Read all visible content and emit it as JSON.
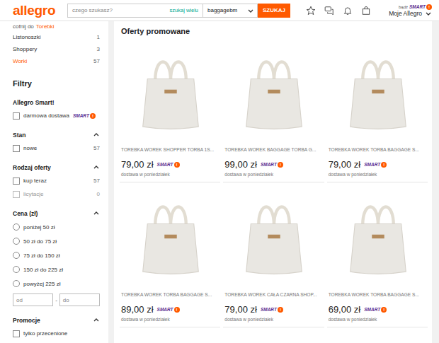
{
  "header": {
    "logo": "allegro",
    "search": {
      "placeholder": "czego szukasz?",
      "link": "szukaj wielu",
      "scope": "baggagebm",
      "button": "SZUKAJ"
    },
    "smart": {
      "prefix": "bądź"
    },
    "account": "Moje Allegro"
  },
  "smart_badge": {
    "label": "SMART",
    "mark": "!"
  },
  "sidebar": {
    "back": {
      "prefix": "cofnij do",
      "link": "Torebki"
    },
    "categories": [
      {
        "label": "Listonoszki",
        "count": "1",
        "selected": false
      },
      {
        "label": "Shoppery",
        "count": "3",
        "selected": false
      },
      {
        "label": "Worki",
        "count": "57",
        "selected": true
      }
    ],
    "filters_title": "Filtry",
    "sections": [
      {
        "title": "Allegro Smart!",
        "items": [
          {
            "kind": "checkbox",
            "label": "darmowa dostawa",
            "smart": true,
            "checked": false,
            "disabled": false
          }
        ]
      },
      {
        "title": "Stan",
        "expanded": true,
        "items": [
          {
            "kind": "checkbox",
            "label": "nowe",
            "count": "57",
            "checked": false,
            "disabled": false
          }
        ]
      },
      {
        "title": "Rodzaj oferty",
        "expanded": true,
        "items": [
          {
            "kind": "checkbox",
            "label": "kup teraz",
            "count": "57",
            "checked": false,
            "disabled": false
          },
          {
            "kind": "checkbox",
            "label": "licytacje",
            "count": "0",
            "checked": false,
            "disabled": true
          }
        ]
      },
      {
        "title": "Cena (zł)",
        "expanded": true,
        "items": [
          {
            "kind": "radio",
            "label": "poniżej 50 zł",
            "selected": false
          },
          {
            "kind": "radio",
            "label": "50 zł do 75 zł",
            "selected": false
          },
          {
            "kind": "radio",
            "label": "75 zł do 150 zł",
            "selected": false
          },
          {
            "kind": "radio",
            "label": "150 zł do 225 zł",
            "selected": false
          },
          {
            "kind": "radio",
            "label": "powyżej 225 zł",
            "selected": false
          },
          {
            "kind": "range",
            "from": "od",
            "separator": "-",
            "to": "do"
          }
        ]
      },
      {
        "title": "Promocje",
        "expanded": true,
        "items": [
          {
            "kind": "checkbox",
            "label": "tylko przecenione",
            "checked": false,
            "disabled": false
          }
        ]
      }
    ]
  },
  "main": {
    "title": "Oferty promowane",
    "products": [
      {
        "title": "TOREBKA WOREK SHOPPER TORBA 1S...",
        "price": "79,00 zł",
        "smart": true,
        "delivery": "dostawa w poniedziałek"
      },
      {
        "title": "TOREBKA WOREK BAGGAGE TORBA G...",
        "price": "99,00 zł",
        "smart": true,
        "delivery": "dostawa w poniedziałek"
      },
      {
        "title": "TOREBKA WOREK TORBA BAGGAGE S...",
        "price": "79,00 zł",
        "smart": true,
        "delivery": "dostawa w poniedziałek"
      },
      {
        "title": "TOREBKA WOREK TORBA BAGGAGE S...",
        "price": "89,00 zł",
        "smart": true,
        "delivery": "dostawa w poniedziałek"
      },
      {
        "title": "TOREBKA WOREK CAŁA CZARNA SHOP...",
        "price": "79,00 zł",
        "smart": true,
        "delivery": "dostawa w poniedziałek"
      },
      {
        "title": "TOREBKA WOREK TORBA BAGGAGE S...",
        "price": "69,00 zł",
        "smart": true,
        "delivery": "dostawa w poniedziałek"
      }
    ]
  }
}
